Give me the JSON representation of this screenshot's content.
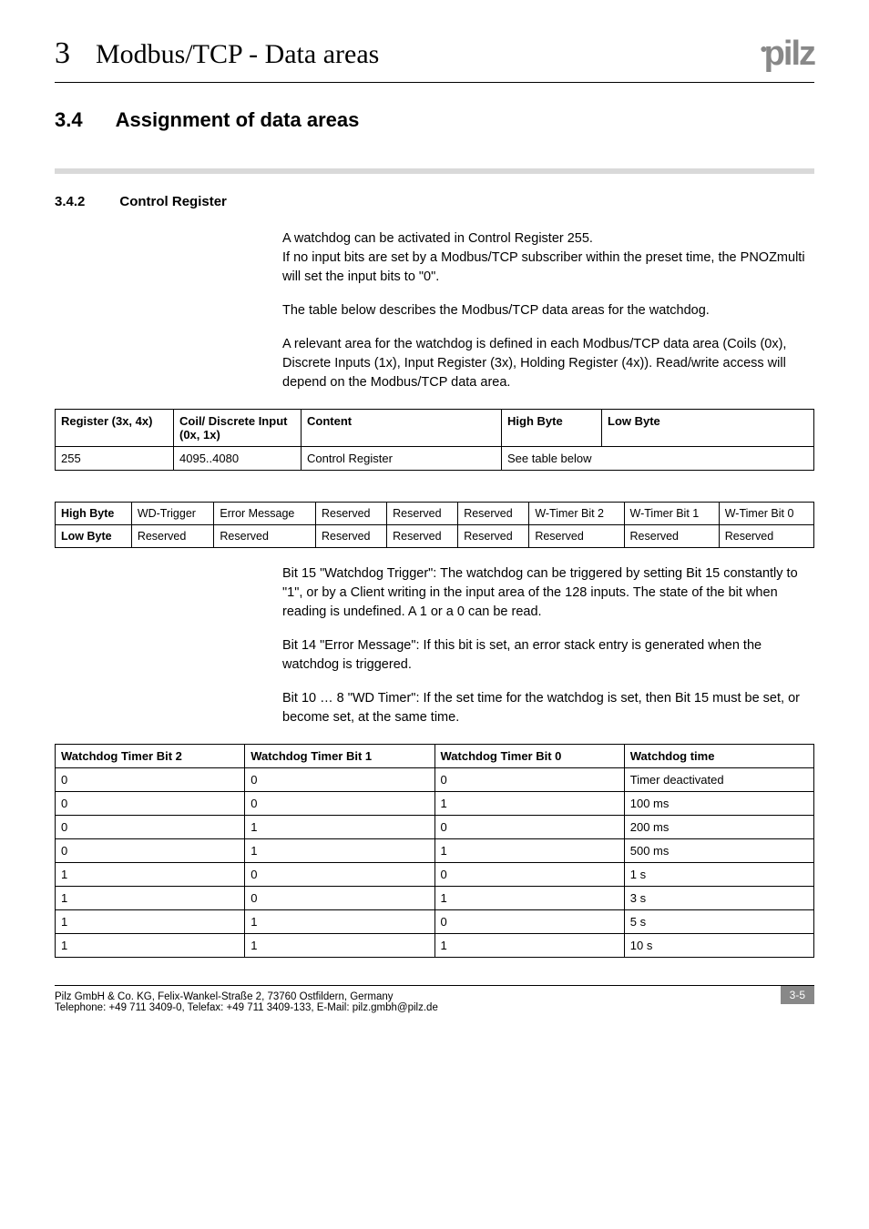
{
  "header": {
    "chapter_num": "3",
    "chapter_title": "Modbus/TCP - Data areas",
    "logo_text": "pilz"
  },
  "section": {
    "num": "3.4",
    "title": "Assignment of data areas"
  },
  "subsection": {
    "num": "3.4.2",
    "title": "Control Register"
  },
  "para1": "A watchdog can be activated in Control Register 255.",
  "para1b": "If no input bits are set by a Modbus/TCP subscriber within the preset time, the PNOZmulti will set the input bits to \"0\".",
  "para2": "The table below describes the Modbus/TCP data areas for the watchdog.",
  "para3": "A relevant area for the watchdog is defined in each Modbus/TCP data area (Coils (0x), Discrete Inputs (1x), Input Register (3x), Holding Register (4x)). Read/write access will depend on the Modbus/TCP data area.",
  "table1": {
    "headers": [
      "Register (3x, 4x)",
      "Coil/\nDiscrete Input (0x, 1x)",
      "Content",
      "High Byte",
      "Low Byte"
    ],
    "row": [
      "255",
      "4095..4080",
      "Control Register",
      "See table below"
    ]
  },
  "table2": {
    "high_label": "High Byte",
    "low_label": "Low Byte",
    "high": [
      "WD-Trigger",
      "Error Message",
      "Reserved",
      "Reserved",
      "Reserved",
      "W-Timer Bit 2",
      "W-Timer Bit 1",
      "W-Timer Bit 0"
    ],
    "low": [
      "Reserved",
      "Reserved",
      "Reserved",
      "Reserved",
      "Reserved",
      "Reserved",
      "Reserved",
      "Reserved"
    ]
  },
  "para4": "Bit 15 \"Watchdog Trigger\": The watchdog can be triggered by setting Bit 15 constantly to \"1\", or by a Client writing in the input area of the 128 inputs. The state of the bit when reading is undefined. A 1 or a 0 can be read.",
  "para5": "Bit 14 \"Error Message\": If this bit is set, an error stack entry is generated when the watchdog is triggered.",
  "para6": "Bit 10 … 8 \"WD Timer\": If the set time for the watchdog is set, then Bit 15 must be set, or become set, at the same time.",
  "table3": {
    "headers": [
      "Watchdog Timer Bit 2",
      "Watchdog Timer Bit 1",
      "Watchdog Timer Bit 0",
      "Watchdog time"
    ],
    "rows": [
      [
        "0",
        "0",
        "0",
        "Timer deactivated"
      ],
      [
        "0",
        "0",
        "1",
        "100 ms"
      ],
      [
        "0",
        "1",
        "0",
        "200 ms"
      ],
      [
        "0",
        "1",
        "1",
        "500 ms"
      ],
      [
        "1",
        "0",
        "0",
        "1 s"
      ],
      [
        "1",
        "0",
        "1",
        "3 s"
      ],
      [
        "1",
        "1",
        "0",
        "5 s"
      ],
      [
        "1",
        "1",
        "1",
        "10 s"
      ]
    ]
  },
  "footer": {
    "line1": "Pilz GmbH & Co. KG, Felix-Wankel-Straße 2, 73760 Ostfildern, Germany",
    "line2": "Telephone: +49 711 3409-0, Telefax: +49 711 3409-133, E-Mail: pilz.gmbh@pilz.de",
    "page": "3-5"
  }
}
